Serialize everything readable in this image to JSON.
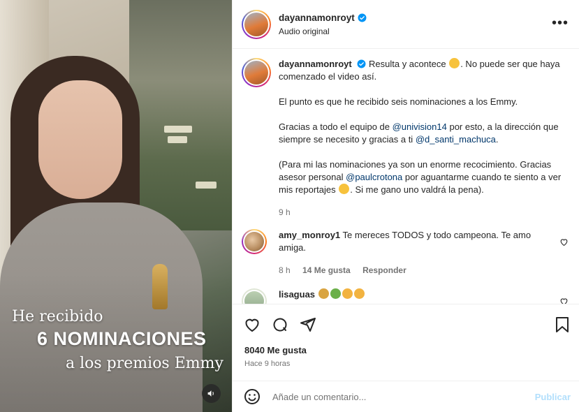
{
  "post_media": {
    "caption_line1": "He recibido",
    "caption_line2": "6 NOMINACIONES",
    "caption_line3": "a los premios Emmy",
    "mute_icon": "speaker-icon"
  },
  "header": {
    "username": "dayannamonroyt",
    "subtitle": "Audio original",
    "more_icon": "more-options-icon"
  },
  "caption": {
    "username": "dayannamonroyt",
    "para1_text": "Resulta y acontece",
    "para1_after": ". No puede ser que haya comenzado el video así.",
    "para2": "El punto es que he recibido seis nominaciones a los Emmy.",
    "para3_a": "Gracias a todo el equipo de ",
    "para3_mention1": "@univision14",
    "para3_b": " por esto, a la dirección que siempre se necesito y gracias a ti ",
    "para3_mention2": "@d_santi_machuca",
    "para3_c": ".",
    "para4_a": "(Para mi las nominaciones ya son un enorme recocimiento. Gracias asesor personal ",
    "para4_mention": "@paulcrotona",
    "para4_b": " por aguantarme cuando te siento a ver mis reportajes",
    "para4_c": ". Si me gano uno valdrá la pena).",
    "time": "9 h"
  },
  "comments": [
    {
      "username": "amy_monroy1",
      "text": "Te mereces TODOS y todo campeona. Te amo amiga.",
      "time": "8 h",
      "likes": "14 Me gusta",
      "reply": "Responder"
    },
    {
      "username": "lisaguas",
      "text": ""
    }
  ],
  "actions": {
    "likes": "8040 Me gusta",
    "ago": "Hace 9 horas"
  },
  "add_comment": {
    "placeholder": "Añade un comentario...",
    "publish": "Publicar"
  },
  "colors": {
    "mention": "#00376b",
    "verified": "#0095f6",
    "publish": "#b2dffc"
  }
}
